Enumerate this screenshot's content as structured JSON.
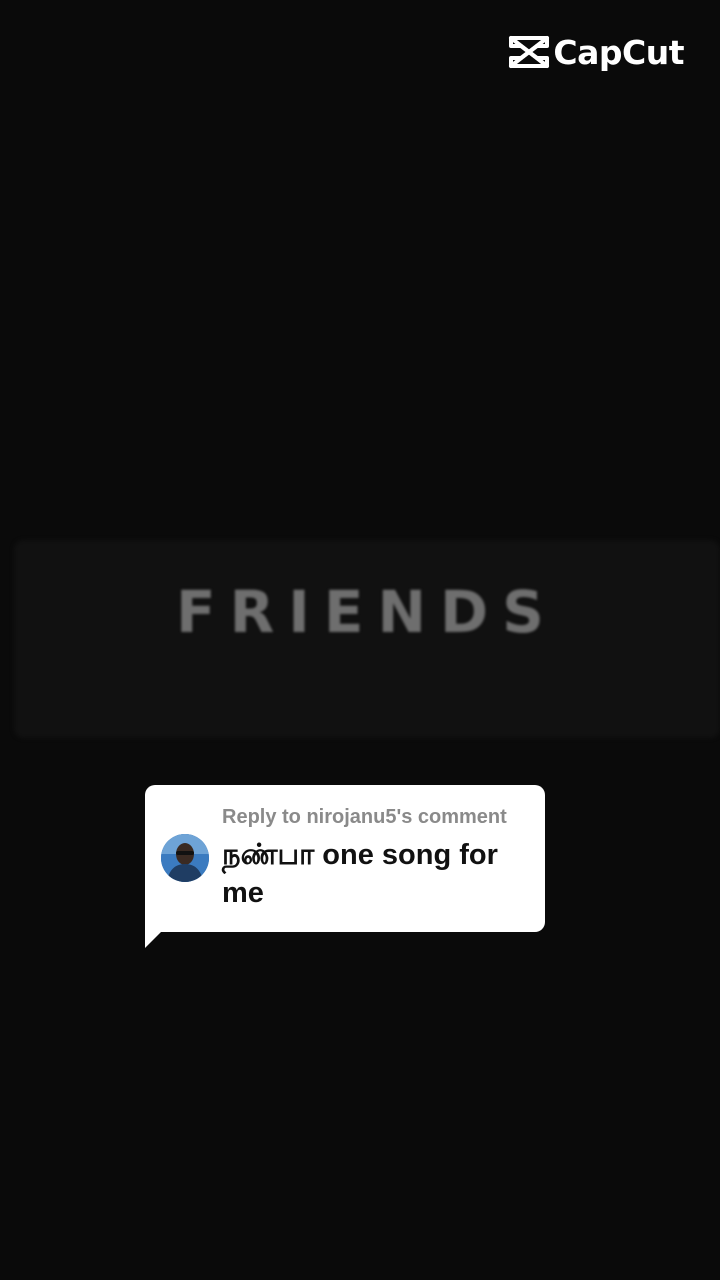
{
  "watermark": {
    "brand": "CapCut",
    "icon": "capcut-logo-icon"
  },
  "video": {
    "title": "FRIENDS"
  },
  "reply_card": {
    "header": "Reply to nirojanu5's comment",
    "comment_text": "நண்பா one song for me",
    "avatar_icon": "avatar-photo"
  },
  "colors": {
    "background": "#0a0a0a",
    "title_gray": "#6e6e6e",
    "bubble": "#ffffff",
    "header_gray": "#8a8a8a"
  }
}
